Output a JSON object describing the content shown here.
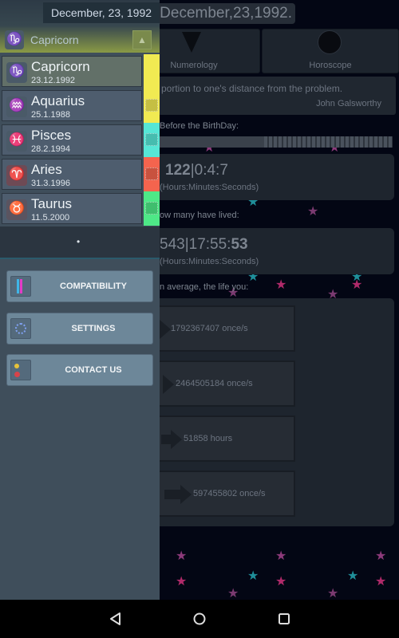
{
  "header": {
    "date_banner": "e:December,23,1992."
  },
  "tabs": [
    {
      "label": "Numerology",
      "icon": "numerology-icon"
    },
    {
      "label": "Horoscope",
      "icon": "horoscope-icon"
    }
  ],
  "quote": {
    "text": "portion to one's distance from the problem.",
    "author": "John Galsworthy"
  },
  "birthday": {
    "label": "Before the BirthDay:",
    "progress_percent": 45,
    "counter_bold": "122",
    "counter_rest": "|0:4:7",
    "unit": "(Hours:Minutes:Seconds)"
  },
  "lived": {
    "label": "ow many have lived:",
    "counter_rest": "543|17:55:",
    "counter_bold": "53",
    "unit": "(Hours:Minutes:Seconds)"
  },
  "average": {
    "label": "n average, the life you:",
    "rows": [
      {
        "value": "1792367407 once/s"
      },
      {
        "value": "2464505184 once/s"
      },
      {
        "value": "51858 hours"
      },
      {
        "value": "597455802 once/s"
      }
    ]
  },
  "drawer": {
    "date": "December, 23, 1992",
    "current_sign": "Capricorn",
    "signs": [
      {
        "name": "Capricorn",
        "date": "23.12.1992",
        "color": "#f1ea52",
        "selected": true
      },
      {
        "name": "Aquarius",
        "date": "25.1.1988",
        "color": "#f1ea52",
        "selected": false
      },
      {
        "name": "Pisces",
        "date": "28.2.1994",
        "color": "#56e6d6",
        "selected": false
      },
      {
        "name": "Aries",
        "date": "31.3.1996",
        "color": "#f4644e",
        "selected": false
      },
      {
        "name": "Taurus",
        "date": "11.5.2000",
        "color": "#4ee887",
        "selected": false
      }
    ],
    "more_button": "•",
    "menu": [
      {
        "label": "COMPATIBILITY",
        "icon": "compatibility-icon"
      },
      {
        "label": "SETTINGS",
        "icon": "settings-icon"
      },
      {
        "label": "CONTACT US",
        "icon": "contact-icon"
      }
    ]
  },
  "navbar": {
    "back": "back",
    "home": "home",
    "recents": "recents"
  }
}
